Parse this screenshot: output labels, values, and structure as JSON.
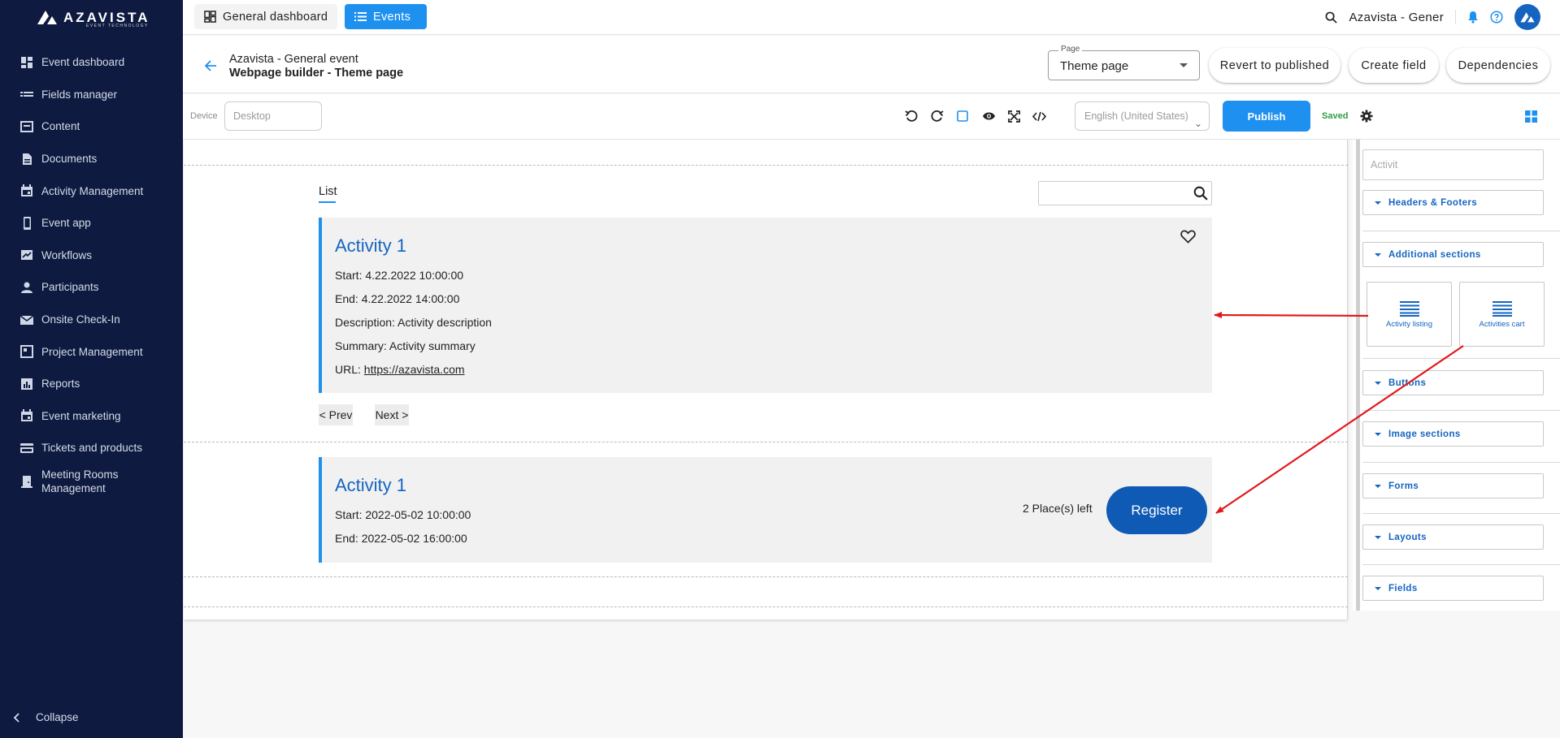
{
  "brand": {
    "name": "AZAVISTA",
    "tagline": "EVENT TECHNOLOGY"
  },
  "sidebar": {
    "items": [
      {
        "label": "Event dashboard",
        "icon": "dashboard-icon"
      },
      {
        "label": "Fields manager",
        "icon": "fields-icon"
      },
      {
        "label": "Content",
        "icon": "content-icon"
      },
      {
        "label": "Documents",
        "icon": "documents-icon"
      },
      {
        "label": "Activity Management",
        "icon": "calendar-icon"
      },
      {
        "label": "Event app",
        "icon": "phone-icon"
      },
      {
        "label": "Workflows",
        "icon": "workflow-icon"
      },
      {
        "label": "Participants",
        "icon": "person-icon"
      },
      {
        "label": "Onsite Check-In",
        "icon": "mail-icon"
      },
      {
        "label": "Project Management",
        "icon": "project-icon"
      },
      {
        "label": "Reports",
        "icon": "reports-icon"
      },
      {
        "label": "Event marketing",
        "icon": "calendar-icon"
      },
      {
        "label": "Tickets and products",
        "icon": "card-icon"
      },
      {
        "label": "Meeting Rooms Management",
        "icon": "room-icon"
      }
    ],
    "collapse_label": "Collapse"
  },
  "topbar": {
    "dashboard_label": "General dashboard",
    "events_label": "Events",
    "org_name": "Azavista - Gener"
  },
  "header": {
    "event_title": "Azavista - General event",
    "subtitle": "Webpage builder - Theme page",
    "page_select": {
      "legend": "Page",
      "value": "Theme page"
    },
    "revert_label": "Revert to published",
    "create_field_label": "Create field",
    "dependencies_label": "Dependencies"
  },
  "toolbar": {
    "device_label": "Device",
    "device_value": "Desktop",
    "language_value": "English (United States)",
    "publish_label": "Publish",
    "status": "Saved"
  },
  "canvas": {
    "tab_label": "List",
    "listing": {
      "title": "Activity 1",
      "start": "Start: 4.22.2022 10:00:00",
      "end": "End: 4.22.2022 14:00:00",
      "description": "Description: Activity description",
      "summary": "Summary: Activity summary",
      "url_prefix": "URL: ",
      "url": "https://azavista.com"
    },
    "prev_label": "< Prev",
    "next_label": "Next >",
    "cart": {
      "title": "Activity 1",
      "start": "Start: 2022-05-02 10:00:00",
      "end": "End: 2022-05-02 16:00:00",
      "places": "2 Place(s) left",
      "register_label": "Register"
    }
  },
  "panel": {
    "filter_value": "Activit",
    "sections": [
      "Headers & Footers",
      "Additional sections",
      "Buttons",
      "Image sections",
      "Forms",
      "Layouts",
      "Fields"
    ],
    "blocks": [
      {
        "label": "Activity listing"
      },
      {
        "label": "Activities cart"
      }
    ]
  },
  "colors": {
    "sidebar_bg": "#0e1a3f",
    "accent": "#1e90f0",
    "register_bg": "#0f5ab4",
    "saved": "#2e9e44",
    "annotation_arrow": "#e0191b"
  }
}
